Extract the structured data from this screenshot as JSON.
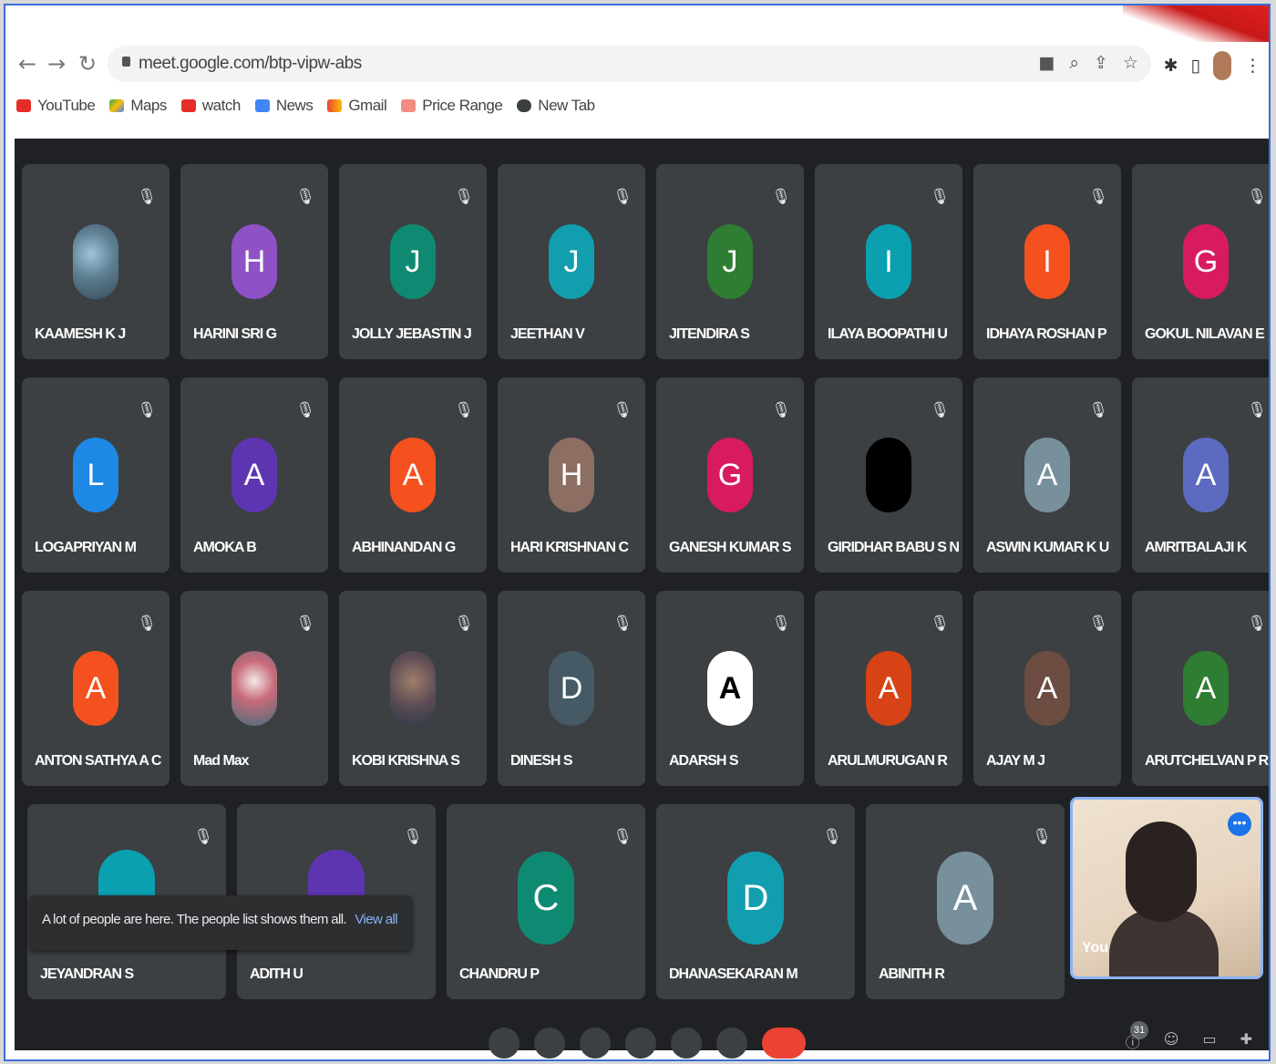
{
  "browser": {
    "url": "meet.google.com/btp-vipw-abs",
    "bookmarks": [
      "YouTube",
      "Maps",
      "watch",
      "News",
      "Gmail",
      "Price Range",
      "New Tab"
    ]
  },
  "tiles": [
    {
      "name": "KAAMESH K J",
      "initial": "",
      "color": "photo"
    },
    {
      "name": "HARINI SRI G",
      "initial": "H",
      "color": "#8e51c6"
    },
    {
      "name": "JOLLY JEBASTIN J",
      "initial": "J",
      "color": "#0f8a72"
    },
    {
      "name": "JEETHAN V",
      "initial": "J",
      "color": "#129eaf"
    },
    {
      "name": "JITENDIRA S",
      "initial": "J",
      "color": "#2e7d32"
    },
    {
      "name": "ILAYA BOOPATHI U",
      "initial": "I",
      "color": "#0aa0b0"
    },
    {
      "name": "IDHAYA ROSHAN P",
      "initial": "I",
      "color": "#f4511e"
    },
    {
      "name": "GOKUL NILAVAN E",
      "initial": "G",
      "color": "#d81b60"
    },
    {
      "name": "LOGAPRIYAN M",
      "initial": "L",
      "color": "#1e88e5"
    },
    {
      "name": "AMOKA B",
      "initial": "A",
      "color": "#5e35b1"
    },
    {
      "name": "ABHINANDAN G",
      "initial": "A",
      "color": "#f4511e"
    },
    {
      "name": "HARI KRISHNAN C",
      "initial": "H",
      "color": "#8d6e63"
    },
    {
      "name": "GANESH KUMAR S",
      "initial": "G",
      "color": "#d81b60"
    },
    {
      "name": "GIRIDHAR BABU S N",
      "initial": "",
      "color": "#000000"
    },
    {
      "name": "ASWIN KUMAR K U",
      "initial": "A",
      "color": "#78909c"
    },
    {
      "name": "AMRITBALAJI K",
      "initial": "A",
      "color": "#5c6bc0"
    },
    {
      "name": "ANTON SATHYA A C",
      "initial": "A",
      "color": "#f4511e"
    },
    {
      "name": "Mad Max",
      "initial": "",
      "color": "photo2"
    },
    {
      "name": "KOBI KRISHNA S",
      "initial": "",
      "color": "photo3"
    },
    {
      "name": "DINESH S",
      "initial": "D",
      "color": "#455a64"
    },
    {
      "name": "ADARSH S",
      "initial": "A",
      "color": "#ffffff"
    },
    {
      "name": "ARULMURUGAN R",
      "initial": "A",
      "color": "#d84315"
    },
    {
      "name": "AJAY M J",
      "initial": "A",
      "color": "#6d4c41"
    },
    {
      "name": "ARUTCHELVAN P R",
      "initial": "A",
      "color": "#2e7d32"
    }
  ],
  "bottom_row": [
    {
      "name": "JEYANDRAN S",
      "initial": "",
      "color": "#0aa0b0"
    },
    {
      "name": "ADITH U",
      "initial": "",
      "color": "#5e35b1"
    },
    {
      "name": "CHANDRU P",
      "initial": "C",
      "color": "#0f8a72"
    },
    {
      "name": "DHANASEKARAN M",
      "initial": "D",
      "color": "#129eaf"
    },
    {
      "name": "ABINITH R",
      "initial": "A",
      "color": "#78909c"
    }
  ],
  "toast": {
    "message": "A lot of people are here. The people list shows them all.",
    "action": "View all"
  },
  "self_view": {
    "label": "You"
  },
  "participant_count": "31"
}
